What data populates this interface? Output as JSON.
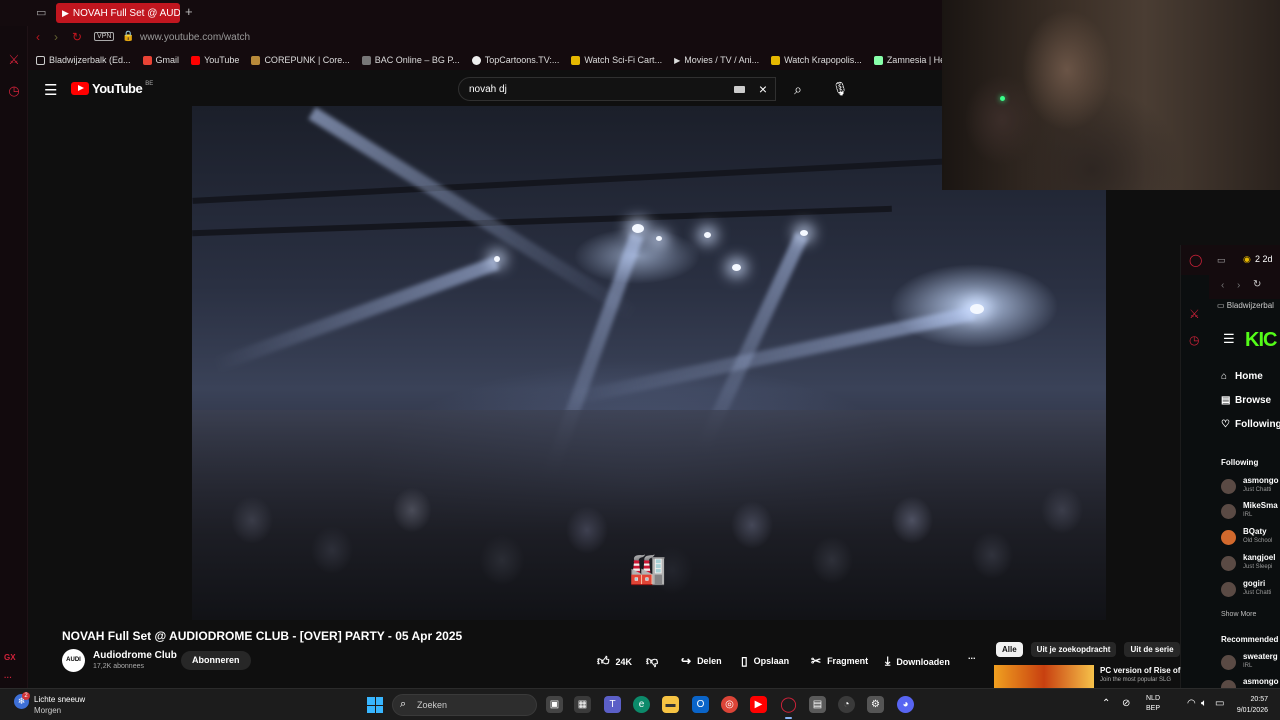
{
  "browser": {
    "tab_title": "NOVAH Full Set @ AUD",
    "url": "www.youtube.com/watch",
    "vpn_label": "VPN",
    "bookmarks": [
      {
        "label": "Bladwijzerbalk (Ed...",
        "icon": "folder-icon"
      },
      {
        "label": "Gmail",
        "icon": "gmail-icon"
      },
      {
        "label": "YouTube",
        "icon": "youtube-icon"
      },
      {
        "label": "COREPUNK | Core...",
        "icon": "corepunk-icon"
      },
      {
        "label": "BAC Online – BG P...",
        "icon": "bac-icon"
      },
      {
        "label": "TopCartoons.TV:...",
        "icon": "topcartoons-icon"
      },
      {
        "label": "Watch Sci-Fi Cart...",
        "icon": "scifi-icon"
      },
      {
        "label": "Movies / TV / Ani...",
        "icon": "play-icon"
      },
      {
        "label": "Watch Krapopolis...",
        "icon": "krapopolis-icon"
      },
      {
        "label": "Zamnesia | Het Be",
        "icon": "zamnesia-icon"
      }
    ]
  },
  "youtube": {
    "logo_text": "YouTube",
    "region": "BE",
    "search_value": "novah dj",
    "video_title": "NOVAH Full Set @ AUDIODROME CLUB - [OVER] PARTY - 05 Apr 2025",
    "channel_name": "Audiodrome Club",
    "channel_avatar_text": "AUDI",
    "subscribers": "17,2K abonnees",
    "subscribe_label": "Abonneren",
    "like_count": "24K",
    "share_label": "Delen",
    "save_label": "Opslaan",
    "clip_label": "Fragment",
    "download_label": "Downloaden",
    "more_label": "...",
    "chips": [
      "Alle",
      "Uit je zoekopdracht",
      "Uit de serie"
    ],
    "recommended": {
      "title": "PC version of Rise of",
      "subtitle": "Join the most popular SLG"
    }
  },
  "kick": {
    "bookmarks_label": "Bladwijzerbal",
    "logo": "KIC",
    "nav": [
      "Home",
      "Browse",
      "Following"
    ],
    "following_header": "Following",
    "following": [
      {
        "name": "asmongo",
        "status": "Just Chatti"
      },
      {
        "name": "MikeSma",
        "status": "IRL"
      },
      {
        "name": "BQaty",
        "status": "Old School"
      },
      {
        "name": "kangjoel",
        "status": "Just Sleepi"
      },
      {
        "name": "gogiri",
        "status": "Just Chatti"
      }
    ],
    "show_more": "Show More",
    "recommended_header": "Recommended",
    "recommended": [
      {
        "name": "sweaterg",
        "status": "IRL"
      },
      {
        "name": "asmongo",
        "status": ""
      }
    ],
    "tab_counter": "2",
    "tab_label": "2d"
  },
  "taskbar": {
    "weather_line1": "Lichte sneeuw",
    "weather_line2": "Morgen",
    "weather_badge": "2",
    "search_placeholder": "Zoeken",
    "lang_line1": "NLD",
    "lang_line2": "BEP",
    "time": "20:57",
    "date": "9/01/2026"
  },
  "colors": {
    "gx_red": "#d1223a",
    "youtube_red": "#ff0000",
    "kick_green": "#53fc18",
    "tab_active": "#c1161f"
  }
}
